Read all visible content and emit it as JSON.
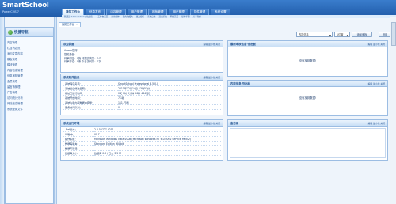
{
  "app": {
    "brand_main": "SmartSchool",
    "brand_sub": "PowerCMS",
    "version_badge": "7"
  },
  "nav": {
    "tabs": [
      "我的工作台",
      "信息发布",
      "内容管理",
      "用户管理",
      "模板管理",
      "用户管理",
      "插件管理",
      "系统设置"
    ],
    "subtabs": [
      "管理员:Admin[Admin] 欢迎您！",
      "工作台首页",
      "常用操作",
      "我的收藏夹",
      "更改密码",
      "系统日志",
      "退出系统",
      "网站首页",
      "操作手册",
      "关于软件"
    ]
  },
  "sidebar": {
    "title": "快捷导航",
    "items": [
      "内容管理",
      "栏目内容页",
      "添加文章内容",
      "模板管理",
      "模块管理",
      "内容信息管理",
      "信息审核管理",
      "会员管理",
      "留言簿管理",
      "广告管理",
      "访问统计分析",
      "网站信息管理",
      "系统配置文件"
    ]
  },
  "window_tab": {
    "label": "我的工作台",
    "close": "x"
  },
  "controls": {
    "filter_select": "内容信息",
    "position_select": "1位置",
    "add_button": "添加面板",
    "settings_button": "设置"
  },
  "panel_actions": "编辑 最小化 关闭",
  "panels": {
    "welcome": {
      "title": "欢迎界面",
      "lines": [
        "Admin您好!",
        "您的角色：",
        "待审内容：0篇 待提交内容：0个",
        "待审评论：0条 今日访问量：0次"
      ]
    },
    "system": {
      "title": "系统软件信息",
      "rows": [
        {
          "k": "系统程序名称：",
          "v": "SmartSchool Professional 3.5.0.0"
        },
        {
          "k": "系统最后修改日期：",
          "v": "2011年12月14日 13时51分"
        },
        {
          "k": "系统已运行时间：",
          "v": "0天 0时 0分钟 26秒 484毫秒"
        },
        {
          "k": "系统开放时间：",
          "v": "7.1版"
        },
        {
          "k": "系统占用内存数据内容量：",
          "v": "111.75M"
        },
        {
          "k": "服务访问队列：",
          "v": "0"
        }
      ]
    },
    "server": {
      "title": "系统运行环境",
      "rows": [
        {
          "k": ".Net版本：",
          "v": "2.0.50727.4211"
        },
        {
          "k": "IIS版本：",
          "v": "IIS 7"
        },
        {
          "k": "操作系统：",
          "v": "Microsoft Windows Vista/2008 (Microsoft Windows NT 6.0.6002 Service Pack 2)"
        },
        {
          "k": "数据库版本：",
          "v": "Standard Edition (64-bit)"
        },
        {
          "k": "数据库路径：",
          "v": ""
        },
        {
          "k": "数据库大小：",
          "v": "数据库 0.0 / 日志 3.5 M"
        }
      ]
    },
    "pending": {
      "title": "最新审核信息-列出板",
      "empty": "没有找到数据!"
    },
    "recent": {
      "title": "内容信息-列出板",
      "empty": "没有找到数据!"
    },
    "memo": {
      "title": "备忘录"
    }
  }
}
